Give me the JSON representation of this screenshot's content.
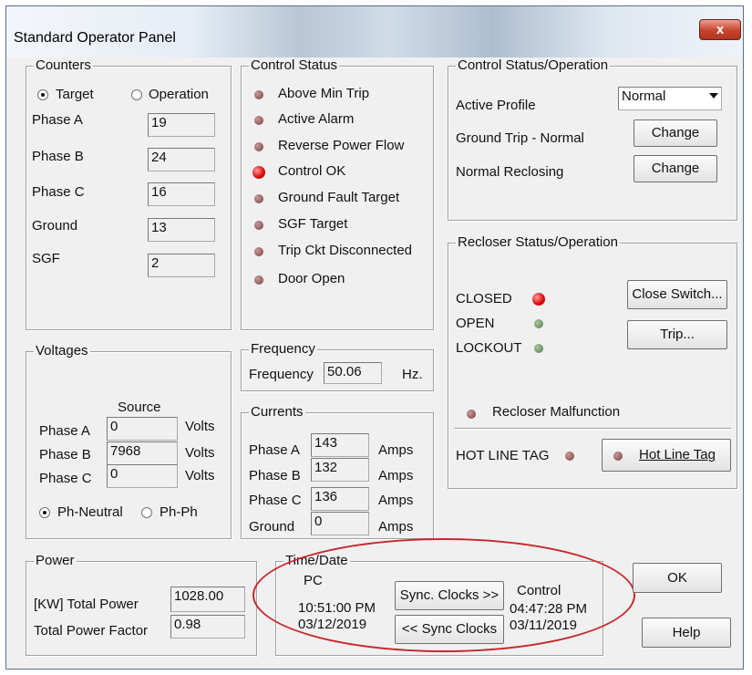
{
  "window": {
    "title": "Standard Operator Panel",
    "close_symbol": "x"
  },
  "counters": {
    "legend": "Counters",
    "radio_target": "Target",
    "radio_operation": "Operation",
    "selected": "Target",
    "rows": [
      {
        "label": "Phase A",
        "value": "19"
      },
      {
        "label": "Phase B",
        "value": "24"
      },
      {
        "label": "Phase C",
        "value": "16"
      },
      {
        "label": "Ground",
        "value": "13"
      },
      {
        "label": "SGF",
        "value": "2"
      }
    ]
  },
  "control_status": {
    "legend": "Control Status",
    "items": [
      {
        "label": "Above Min Trip",
        "state": "off"
      },
      {
        "label": "Active Alarm",
        "state": "off"
      },
      {
        "label": "Reverse Power Flow",
        "state": "off"
      },
      {
        "label": "Control OK",
        "state": "on"
      },
      {
        "label": "Ground Fault Target",
        "state": "off"
      },
      {
        "label": "SGF Target",
        "state": "off"
      },
      {
        "label": "Trip Ckt Disconnected",
        "state": "off"
      },
      {
        "label": "Door Open",
        "state": "off"
      }
    ]
  },
  "control_operation": {
    "legend": "Control Status/Operation",
    "active_profile_label": "Active Profile",
    "active_profile_value": "Normal",
    "ground_trip_label": "Ground Trip - Normal",
    "ground_trip_button": "Change",
    "reclosing_label": "Normal Reclosing",
    "reclosing_button": "Change"
  },
  "recloser": {
    "legend": "Recloser Status/Operation",
    "closed_label": "CLOSED",
    "open_label": "OPEN",
    "lockout_label": "LOCKOUT",
    "close_switch_button": "Close Switch...",
    "trip_button": "Trip...",
    "malfunction_label": "Recloser Malfunction",
    "hot_line_tag_label": "HOT LINE TAG",
    "hot_line_tag_button": "Hot Line Tag",
    "closed_color": "#e01010",
    "open_color": "#4e7a48"
  },
  "voltages": {
    "legend": "Voltages",
    "source_header": "Source",
    "unit": "Volts",
    "rows": [
      {
        "label": "Phase A",
        "value": "0"
      },
      {
        "label": "Phase B",
        "value": "7968"
      },
      {
        "label": "Phase C",
        "value": "0"
      }
    ],
    "radio_ph_neutral": "Ph-Neutral",
    "radio_ph_ph": "Ph-Ph",
    "selected": "Ph-Neutral"
  },
  "frequency": {
    "legend": "Frequency",
    "label": "Frequency",
    "value": "50.06",
    "unit": "Hz."
  },
  "currents": {
    "legend": "Currents",
    "unit": "Amps",
    "rows": [
      {
        "label": "Phase A",
        "value": "143"
      },
      {
        "label": "Phase B",
        "value": "132"
      },
      {
        "label": "Phase C",
        "value": "136"
      },
      {
        "label": "Ground",
        "value": "0"
      }
    ]
  },
  "power": {
    "legend": "Power",
    "total_power_label": "[KW] Total Power",
    "total_power_value": "1028.00",
    "power_factor_label": "Total Power Factor",
    "power_factor_value": "0.98"
  },
  "time_date": {
    "legend": "Time/Date",
    "pc_label": "PC",
    "pc_time": "10:51:00 PM",
    "pc_date": "03/12/2019",
    "sync_to_control_button": "Sync. Clocks >>",
    "sync_to_pc_button": "<< Sync Clocks",
    "control_label": "Control",
    "control_time": "04:47:28 PM",
    "control_date": "03/11/2019",
    "highlight_color": "#c6282c"
  },
  "actions": {
    "ok_button": "OK",
    "help_button": "Help"
  }
}
